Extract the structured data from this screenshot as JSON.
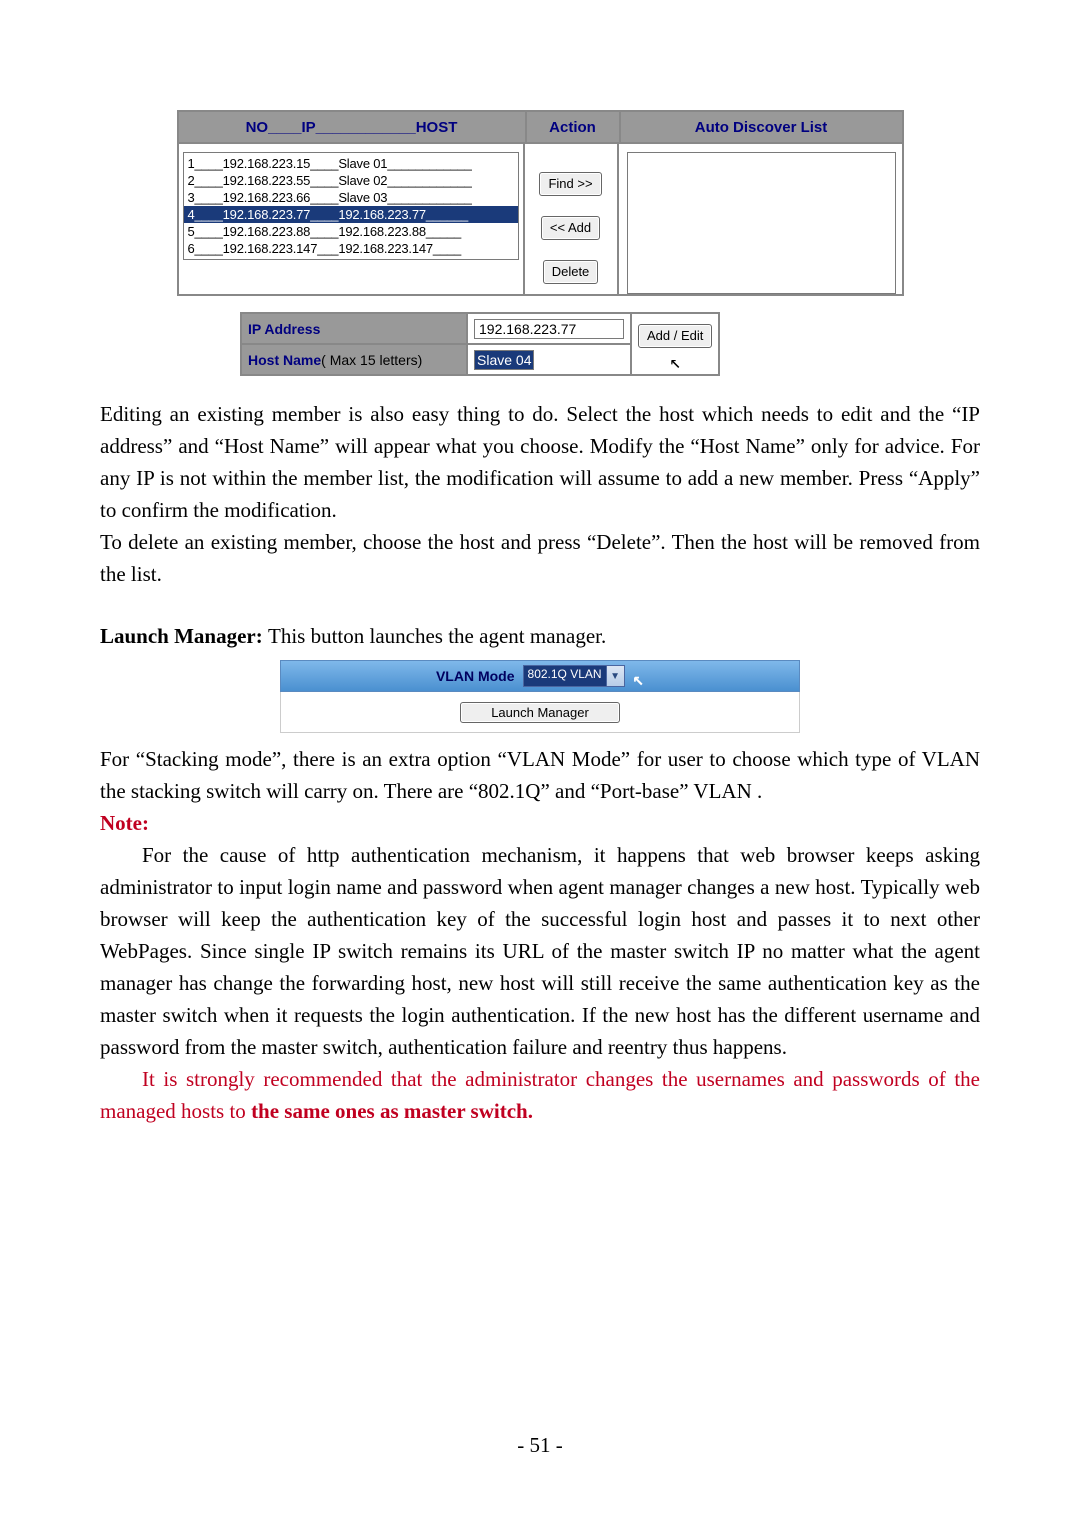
{
  "fig1": {
    "header": {
      "left": "NO____IP____________HOST",
      "action": "Action",
      "discover": "Auto Discover List"
    },
    "rows": [
      {
        "text": "1____192.168.223.15____Slave 01____________",
        "selected": false
      },
      {
        "text": "2____192.168.223.55____Slave 02____________",
        "selected": false
      },
      {
        "text": "3____192.168.223.66____Slave 03____________",
        "selected": false
      },
      {
        "text": "4____192.168.223.77____192.168.223.77______",
        "selected": true
      },
      {
        "text": "5____192.168.223.88____192.168.223.88_____",
        "selected": false
      },
      {
        "text": "6____192.168.223.147___192.168.223.147____",
        "selected": false
      }
    ],
    "buttons": {
      "find": "Find >>",
      "add": "<< Add",
      "del": "Delete"
    }
  },
  "fig2": {
    "ip_label": "IP Address",
    "ip_value": "192.168.223.77",
    "host_label": "Host Name",
    "host_hint": "( Max 15 letters)",
    "host_value": "Slave 04",
    "btn": "Add / Edit"
  },
  "para1a": "Editing an existing member is also easy thing to do. Select the host which needs to edit and the “IP address” and “Host Name” will appear what you choose. Modify the “Host Name” only for advice. For any IP is not within the member list, the modification will assume to add a new member. Press “Apply” to confirm the modification.",
  "para1b": "To delete an existing member, choose the host and press “Delete”. Then the host will be removed from the list.",
  "launch_label": "Launch Manager: ",
  "launch_text": "This button launches the agent manager.",
  "fig3": {
    "label": "VLAN Mode",
    "value": "802.1Q VLAN",
    "btn": "Launch Manager"
  },
  "para2": "For “Stacking mode”, there is an extra option “VLAN Mode” for user to choose which type of VLAN the stacking switch will carry on. There are “802.1Q” and “Port-base” VLAN .",
  "note_label": "Note:",
  "note1": "For the cause of http authentication mechanism, it happens that web browser keeps asking administrator to input login name and password when agent manager changes a new host. Typically web browser will keep the authentication key of the successful login host and passes it to next other WebPages. Since single IP switch remains its URL of the master switch IP no matter what the agent manager has change the forwarding host, new host will still receive the same authentication key as the master switch when it requests the login authentication. If the new host has the different username and password from the master switch, authentication failure and reentry thus happens.",
  "note2a": "It is strongly recommended that the administrator changes the usernames and passwords of the managed hosts to ",
  "note2b": "the same ones as master switch.",
  "page_no": "- 51 -"
}
